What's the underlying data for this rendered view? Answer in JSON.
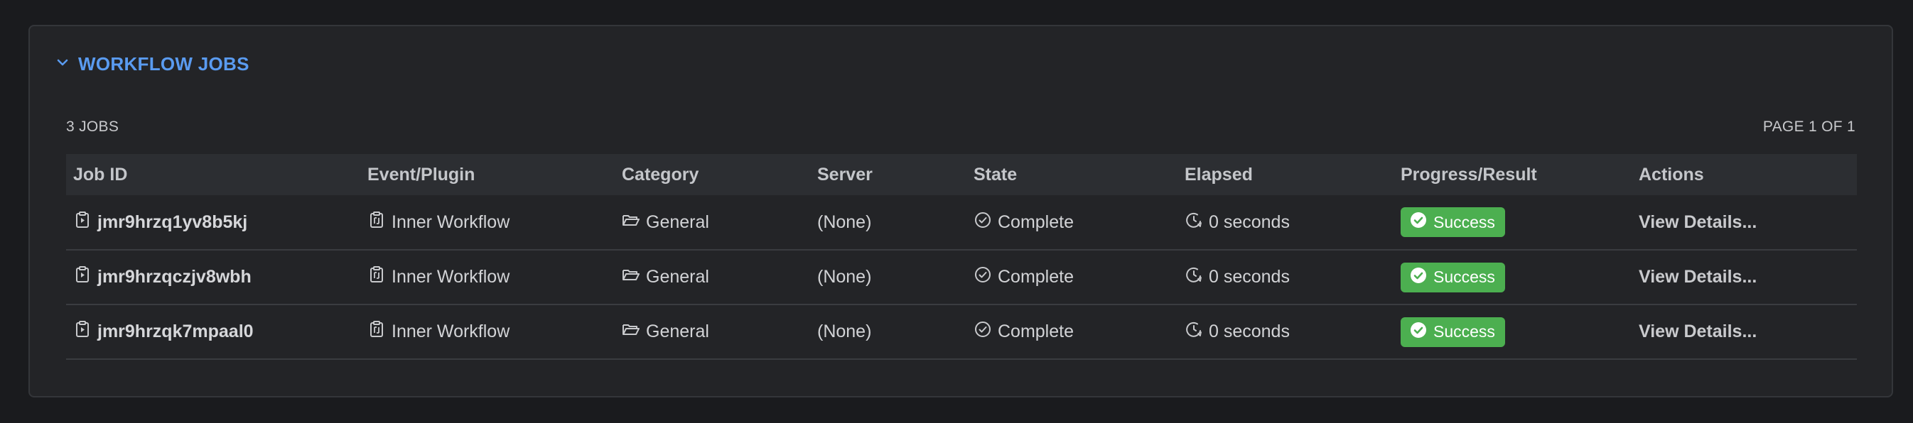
{
  "section": {
    "title": "WORKFLOW JOBS",
    "icon": "chevron-down-icon"
  },
  "meta": {
    "count_label": "3 JOBS",
    "page_label": "PAGE 1 OF 1"
  },
  "columns": [
    "Job ID",
    "Event/Plugin",
    "Category",
    "Server",
    "State",
    "Elapsed",
    "Progress/Result",
    "Actions"
  ],
  "rows": [
    {
      "job_id": "jmr9hrzq1yv8b5kj",
      "event": "Inner Workflow",
      "category": "General",
      "server": "(None)",
      "state": "Complete",
      "elapsed": "0 seconds",
      "result": "Success",
      "action": "View Details..."
    },
    {
      "job_id": "jmr9hrzqczjv8wbh",
      "event": "Inner Workflow",
      "category": "General",
      "server": "(None)",
      "state": "Complete",
      "elapsed": "0 seconds",
      "result": "Success",
      "action": "View Details..."
    },
    {
      "job_id": "jmr9hrzqk7mpaal0",
      "event": "Inner Workflow",
      "category": "General",
      "server": "(None)",
      "state": "Complete",
      "elapsed": "0 seconds",
      "result": "Success",
      "action": "View Details..."
    }
  ],
  "colors": {
    "background": "#1a1b1e",
    "panel": "#232427",
    "accent": "#5a9bf0",
    "success": "#4caf50"
  }
}
